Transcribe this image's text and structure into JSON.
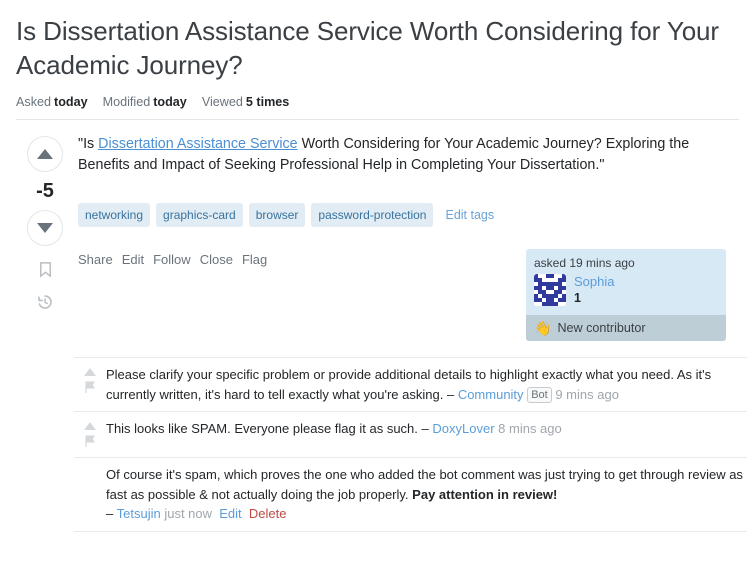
{
  "question": {
    "title": "Is Dissertation Assistance Service Worth Considering for Your Academic Journey?",
    "meta": [
      {
        "label": "Asked",
        "value": "today"
      },
      {
        "label": "Modified",
        "value": "today"
      },
      {
        "label": "Viewed",
        "value": "5 times"
      }
    ],
    "score": "-5",
    "body_prefix": "\"Is ",
    "body_link": "Dissertation Assistance Service",
    "body_rest": " Worth Considering for Your Academic Journey? Exploring the Benefits and Impact of Seeking Professional Help in Completing Your Dissertation.\"",
    "tags": [
      "networking",
      "graphics-card",
      "browser",
      "password-protection"
    ],
    "edit_tags_label": "Edit tags",
    "actions": [
      "Share",
      "Edit",
      "Follow",
      "Close",
      "Flag"
    ]
  },
  "user_card": {
    "asked_label": "asked 19 mins ago",
    "username": "Sophia",
    "reputation": "1",
    "new_contributor_label": "New contributor",
    "wave_icon": "wave-hand-icon",
    "bg_color": "#d6e9f5",
    "badge_bg_color": "#bdced6"
  },
  "comments": [
    {
      "text": "Please clarify your specific problem or provide additional details to highlight exactly what you need. As it's currently written, it's hard to tell exactly what you're asking.",
      "dash": "–",
      "author": "Community",
      "badge": "Bot",
      "date": "9 mins ago"
    },
    {
      "text": "This looks like SPAM. Everyone please flag it as such.",
      "dash": "–",
      "author": "DoxyLover",
      "badge": "",
      "date": "8 mins ago"
    },
    {
      "text": "Of course it's spam, which proves the one who added the bot comment was just trying to get through review as fast as possible & not actually doing the job properly. ",
      "bold_text": "Pay attention in review!",
      "dash": "–",
      "author": "Tetsujin",
      "badge": "",
      "date": "just now",
      "edit_label": "Edit",
      "delete_label": "Delete"
    }
  ],
  "colors": {
    "link": "#5b9dd9",
    "body_link": "#4a8fd4",
    "tag_bg": "#e1ecf4",
    "tag_text": "#39739d",
    "delete_red": "#c04a44",
    "muted": "#6a737c"
  },
  "icons": {
    "upvote": "triangle-up-icon",
    "downvote": "triangle-down-icon",
    "bookmark": "bookmark-icon",
    "history": "history-clock-icon",
    "flag": "flag-icon"
  }
}
